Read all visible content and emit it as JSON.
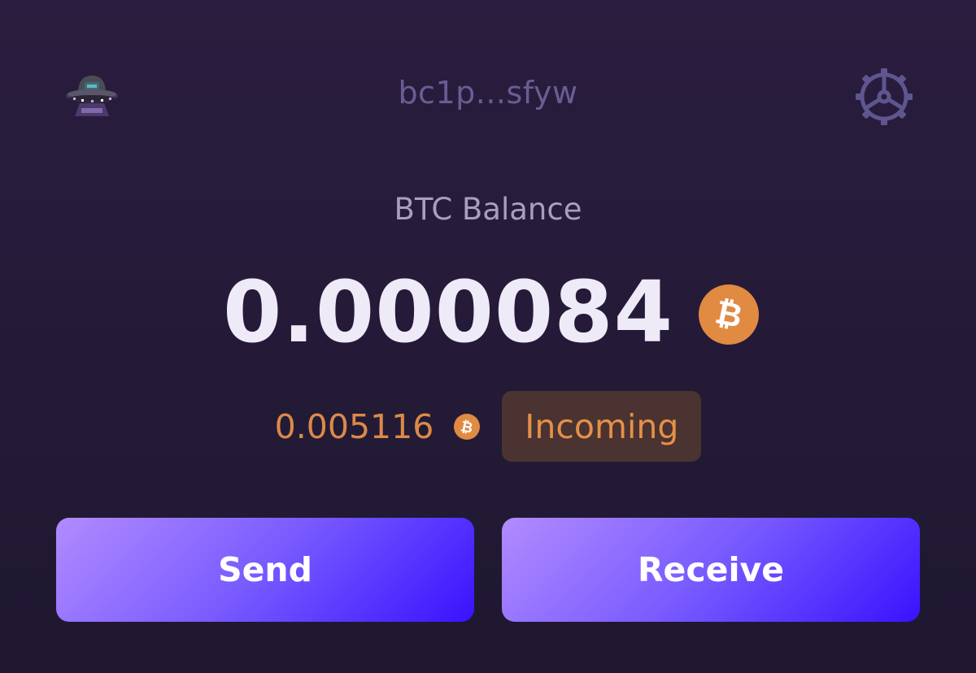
{
  "header": {
    "avatar_icon": "ufo-avatar-icon",
    "address": "bc1p...sfyw",
    "settings_icon": "gear-icon"
  },
  "balance": {
    "label": "BTC Balance",
    "value": "0.000084",
    "currency_icon": "bitcoin-icon"
  },
  "incoming": {
    "value": "0.005116",
    "currency_icon": "bitcoin-icon",
    "badge": "Incoming"
  },
  "actions": {
    "send_label": "Send",
    "receive_label": "Receive"
  },
  "colors": {
    "background_top": "#2a1d3f",
    "background_bottom": "#1f1830",
    "bitcoin_orange": "#e08a42",
    "incoming_text": "#dc8a48",
    "badge_background": "#4a3331",
    "button_gradient_start": "#b18bff",
    "button_gradient_end": "#3a12ff"
  }
}
